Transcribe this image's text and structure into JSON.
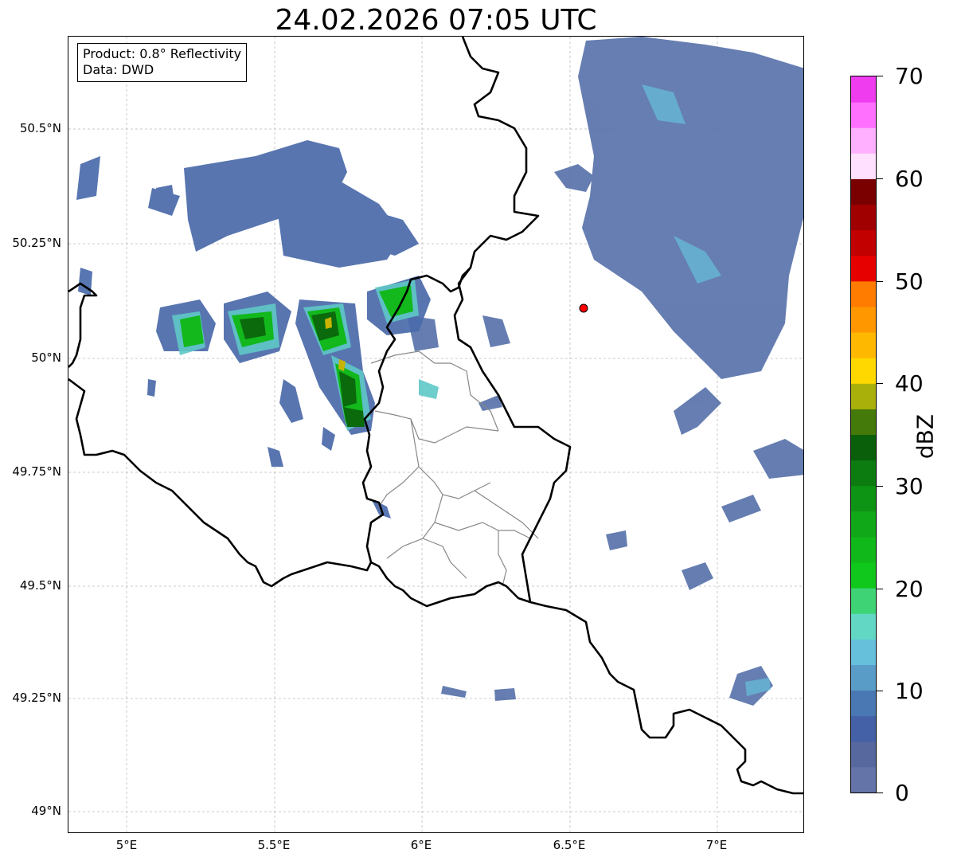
{
  "title": "24.02.2026 07:05 UTC",
  "info_box": {
    "product": "Product: 0.8° Reflectivity",
    "data": "Data: DWD"
  },
  "lat_ticks": [
    "50.5°N",
    "50.25°N",
    "50°N",
    "49.75°N",
    "49.5°N",
    "49.25°N",
    "49°N"
  ],
  "lon_ticks": [
    "5°E",
    "5.5°E",
    "6°E",
    "6.5°E",
    "7°E"
  ],
  "colorbar": {
    "label": "dBZ",
    "ticks": [
      "70",
      "60",
      "50",
      "40",
      "30",
      "20",
      "10",
      "0"
    ],
    "range": [
      0,
      70
    ],
    "colors": [
      "#6474a8",
      "#56689e",
      "#4460a6",
      "#4a78b2",
      "#5a9cc8",
      "#66c0dc",
      "#62d8c4",
      "#3ed476",
      "#10c81c",
      "#10b81a",
      "#10a818",
      "#0e9414",
      "#0c7c10",
      "#0a600a",
      "#447a0a",
      "#aab00a",
      "#ffd800",
      "#ffb800",
      "#ff9800",
      "#ff7c00",
      "#e60000",
      "#c20000",
      "#a00000",
      "#7a0000",
      "#ffe0ff",
      "#ffb0ff",
      "#ff70ff",
      "#ee3cee"
    ]
  },
  "marker": {
    "color": "#ff0000",
    "lon": 6.55,
    "lat": 50.11
  }
}
